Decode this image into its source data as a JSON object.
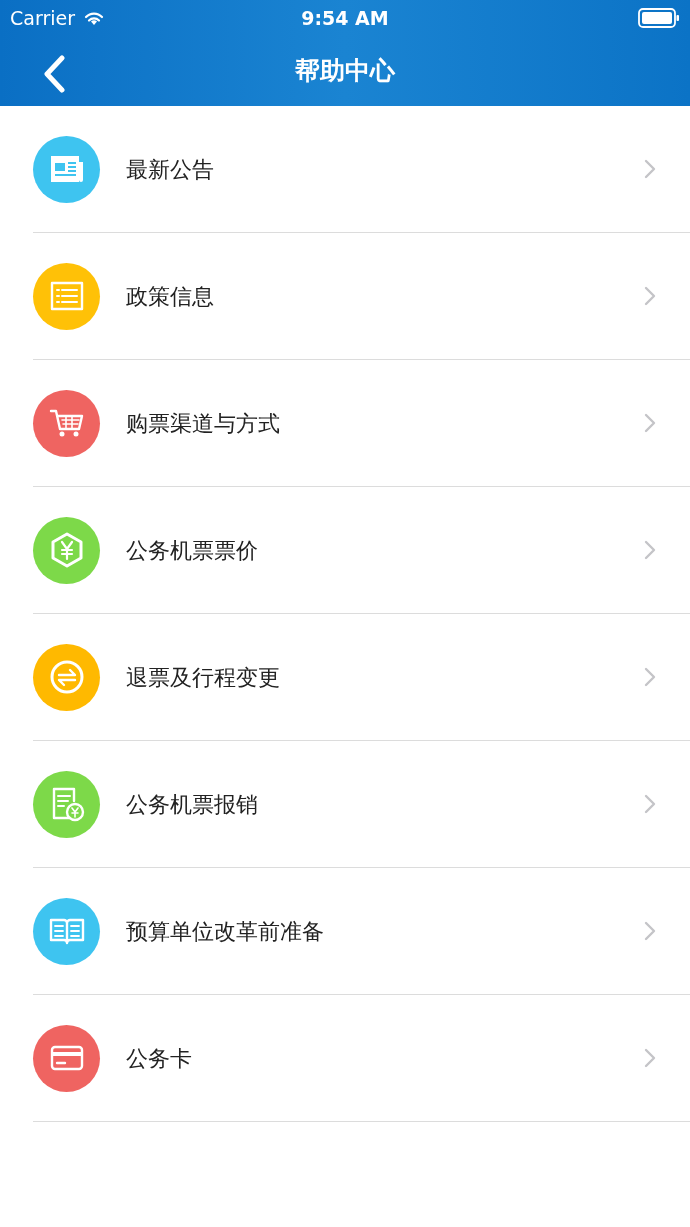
{
  "status_bar": {
    "carrier": "Carrier",
    "time": "9:54 AM"
  },
  "nav_bar": {
    "title": "帮助中心"
  },
  "items": [
    {
      "label": "最新公告",
      "color": "#3ec4f0",
      "kind": "news"
    },
    {
      "label": "政策信息",
      "color": "#ffc107",
      "kind": "list"
    },
    {
      "label": "购票渠道与方式",
      "color": "#ef6461",
      "kind": "cart"
    },
    {
      "label": "公务机票票价",
      "color": "#7dd949",
      "kind": "price"
    },
    {
      "label": "退票及行程变更",
      "color": "#ffb900",
      "kind": "exchange"
    },
    {
      "label": "公务机票报销",
      "color": "#7dd949",
      "kind": "receipt"
    },
    {
      "label": "预算单位改革前准备",
      "color": "#3ec4f0",
      "kind": "book"
    },
    {
      "label": "公务卡",
      "color": "#ef6461",
      "kind": "card"
    }
  ]
}
